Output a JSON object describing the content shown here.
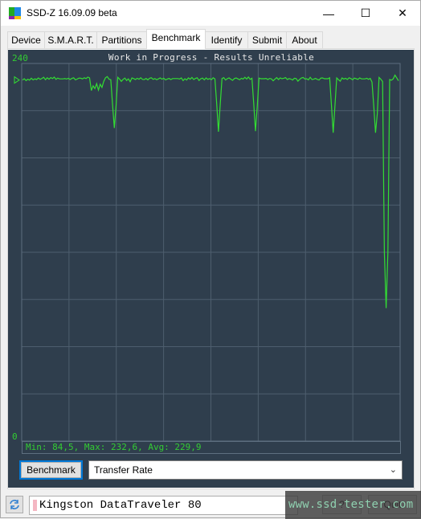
{
  "window": {
    "title": "SSD-Z 16.09.09 beta",
    "controls": {
      "minimize": "—",
      "maximize": "☐",
      "close": "✕"
    }
  },
  "tabs": [
    {
      "label": "Device",
      "active": false
    },
    {
      "label": "S.M.A.R.T.",
      "active": false
    },
    {
      "label": "Partitions",
      "active": false
    },
    {
      "label": "Benchmark",
      "active": true
    },
    {
      "label": "Identify",
      "active": false
    },
    {
      "label": "Submit",
      "active": false
    },
    {
      "label": "About",
      "active": false
    }
  ],
  "benchmark": {
    "run_button": "Benchmark",
    "mode_select": {
      "value": "Transfer Rate"
    },
    "stats": "Min: 84,5, Max: 232,6, Avg: 229,9"
  },
  "status_bar": {
    "drive_name": "Kingston DataTraveler 80",
    "buttons": [
      "?",
      "Quit"
    ]
  },
  "watermark": "www.ssd-tester.com",
  "colors": {
    "chart_bg": "#2f3e4d",
    "grid": "#4e5e6e",
    "series": "#33dd33",
    "label": "#33cc33",
    "title": "#e8e8e8"
  },
  "chart_data": {
    "type": "line",
    "title": "Work in Progress - Results Unreliable",
    "xlabel": "",
    "ylabel": "",
    "ylim": [
      0,
      240
    ],
    "y_tick_labels": {
      "max": "240",
      "min": "0"
    },
    "grid": true,
    "grid_divisions": {
      "x": 8,
      "y": 8
    },
    "marker_value": 229.5,
    "series": [
      {
        "name": "Transfer Rate",
        "values": [
          229.5,
          230.3,
          229.1,
          230.0,
          229.4,
          230.6,
          229.6,
          230.2,
          229.8,
          230.8,
          229.9,
          230.5,
          231.2,
          229.7,
          230.9,
          230.0,
          231.0,
          230.4,
          231.3,
          229.9,
          230.7,
          230.2,
          230.2,
          230.2,
          230.4,
          230.1,
          230.6,
          229.8,
          230.5,
          230.9,
          229.6,
          230.1,
          230.7,
          230.6,
          230.2,
          230.9,
          230.4,
          231.3,
          230.8,
          222.8,
          225.8,
          224.0,
          227.2,
          223.1,
          226.8,
          224.8,
          228.6,
          230.9,
          231.7,
          230.0,
          229.7,
          213.8,
          199.0,
          213.5,
          231.2,
          230.1,
          228.6,
          229.9,
          230.7,
          229.2,
          230.2,
          228.4,
          230.8,
          230.4,
          229.8,
          230.6,
          230.0,
          230.9,
          229.9,
          229.8,
          230.5,
          229.6,
          230.6,
          230.9,
          229.9,
          230.4,
          229.7,
          230.2,
          230.8,
          230.0,
          230.6,
          229.6,
          230.1,
          230.5,
          229.8,
          230.4,
          230.4,
          230.4,
          230.4,
          230.1,
          230.8,
          229.1,
          230.3,
          229.5,
          230.8,
          230.0,
          231.1,
          229.8,
          230.5,
          230.9,
          229.2,
          230.3,
          230.7,
          229.6,
          230.8,
          229.9,
          230.4,
          229.7,
          230.9,
          230.2,
          214.5,
          196.6,
          214.0,
          230.4,
          231.0,
          229.5,
          230.3,
          230.8,
          230.0,
          229.3,
          230.4,
          230.8,
          230.2,
          229.7,
          230.6,
          230.1,
          231.2,
          230.1,
          231.4,
          229.9,
          230.6,
          214.5,
          197.0,
          212.8,
          230.7,
          230.3,
          230.3,
          230.3,
          230.5,
          229.8,
          230.5,
          230.2,
          229.0,
          230.1,
          231.0,
          229.8,
          230.8,
          230.3,
          230.6,
          231.0,
          229.8,
          230.4,
          230.1,
          229.5,
          230.6,
          230.4,
          228.7,
          229.9,
          230.8,
          231.1,
          230.1,
          230.3,
          229.6,
          231.2,
          229.8,
          230.0,
          230.5,
          229.9,
          229.5,
          230.7,
          230.8,
          230.3,
          230.3,
          230.3,
          230.9,
          213.8,
          196.0,
          213.2,
          230.8,
          229.7,
          228.7,
          230.8,
          230.1,
          230.6,
          229.8,
          230.9,
          230.4,
          229.6,
          230.7,
          230.3,
          229.9,
          230.8,
          230.2,
          230.2,
          230.2,
          230.6,
          229.9,
          230.5,
          228.2,
          213.0,
          196.0,
          208.0,
          231.1,
          230.0,
          228.5,
          120.0,
          84.5,
          120.0,
          229.8,
          229.4,
          230.2,
          232.6,
          230.8,
          229.0
        ]
      }
    ]
  }
}
